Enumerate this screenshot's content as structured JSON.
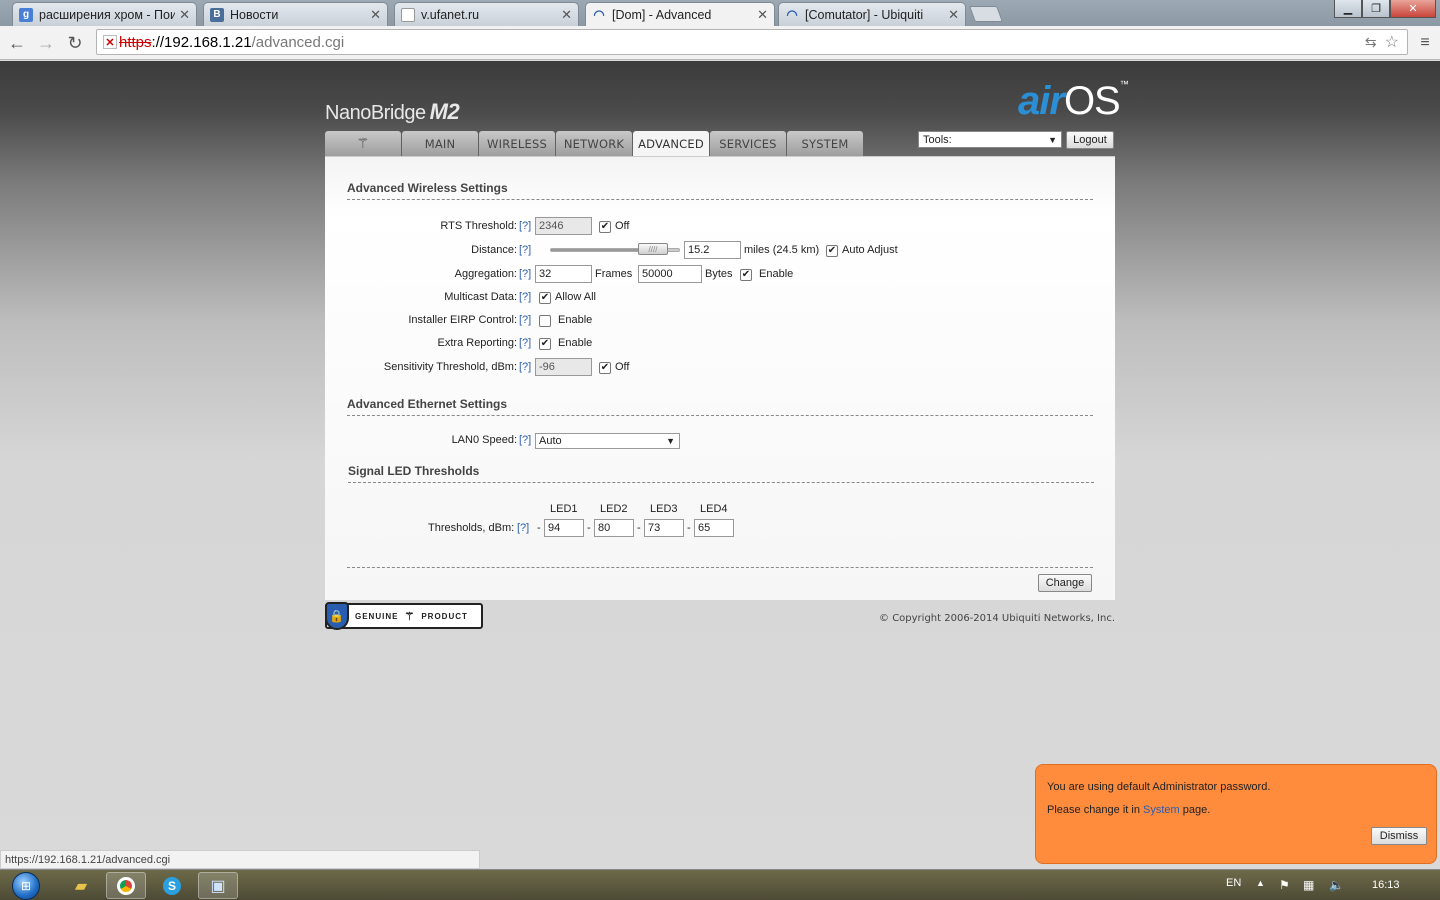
{
  "browser": {
    "tabs": [
      {
        "title": "расширения хром - Пои",
        "fav": "g",
        "favColor": "#4a7fd6",
        "active": false
      },
      {
        "title": "Новости",
        "fav": "B",
        "favColor": "#4a6e9a",
        "active": false
      },
      {
        "title": "v.ufanet.ru",
        "fav": "",
        "favColor": "#ffffff",
        "active": false
      },
      {
        "title": "[Dom] - Advanced",
        "fav": "rss",
        "favColor": "#2a5db0",
        "active": true
      },
      {
        "title": "[Comutator] - Ubiquiti",
        "fav": "rss",
        "favColor": "#2a5db0",
        "active": false
      }
    ],
    "url_scheme": "https",
    "url_host": "://192.168.1.21",
    "url_path": "/advanced.cgi",
    "status_url": "https://192.168.1.21/advanced.cgi"
  },
  "header": {
    "brand": "NanoBridge",
    "brand_model": "M2",
    "logo_air": "air",
    "logo_os": "OS",
    "logo_tm": "™",
    "nav": [
      "MAIN",
      "WIRELESS",
      "NETWORK",
      "ADVANCED",
      "SERVICES",
      "SYSTEM"
    ],
    "active_nav": "ADVANCED",
    "tools_label": "Tools:",
    "logout": "Logout"
  },
  "wireless": {
    "title": "Advanced Wireless Settings",
    "help": "[?]",
    "rts": {
      "label": "RTS Threshold:",
      "value": "2346",
      "off_label": "Off",
      "off_checked": true
    },
    "distance": {
      "label": "Distance:",
      "value": "15.2",
      "unit": "miles (24.5 km)",
      "auto_label": "Auto Adjust",
      "auto_checked": true,
      "slider_fraction": 0.87
    },
    "aggregation": {
      "label": "Aggregation:",
      "frames": "32",
      "frames_label": "Frames",
      "bytes": "50000",
      "bytes_label": "Bytes",
      "enable_label": "Enable",
      "enable_checked": true
    },
    "multicast": {
      "label": "Multicast Data:",
      "allow_label": "Allow All",
      "checked": true
    },
    "eirp": {
      "label": "Installer EIRP Control:",
      "enable_label": "Enable",
      "checked": false
    },
    "extra": {
      "label": "Extra Reporting:",
      "enable_label": "Enable",
      "checked": true
    },
    "sensitivity": {
      "label": "Sensitivity Threshold, dBm:",
      "value": "-96",
      "off_label": "Off",
      "off_checked": true
    }
  },
  "ethernet": {
    "title": "Advanced Ethernet Settings",
    "lan_label": "LAN0 Speed:",
    "lan_value": "Auto"
  },
  "led": {
    "title": "Signal LED Thresholds",
    "label": "Thresholds, dBm:",
    "headers": [
      "LED1",
      "LED2",
      "LED3",
      "LED4"
    ],
    "values": [
      "94",
      "80",
      "73",
      "65"
    ],
    "sign": "-"
  },
  "actions": {
    "change": "Change"
  },
  "footer": {
    "genuine": "GENUINE",
    "product": "PRODUCT",
    "copyright": "© Copyright 2006-2014 Ubiquiti Networks, Inc."
  },
  "notification": {
    "line1": "You are using default Administrator password.",
    "line2_pre": "Please change it in ",
    "line2_link": "System",
    "line2_post": " page.",
    "dismiss": "Dismiss"
  },
  "taskbar": {
    "lang": "EN",
    "clock": "16:13"
  },
  "colors": {
    "accent": "#2a5db0",
    "notify": "#ff8b3d",
    "logo_blue": "#2b8fd6"
  }
}
